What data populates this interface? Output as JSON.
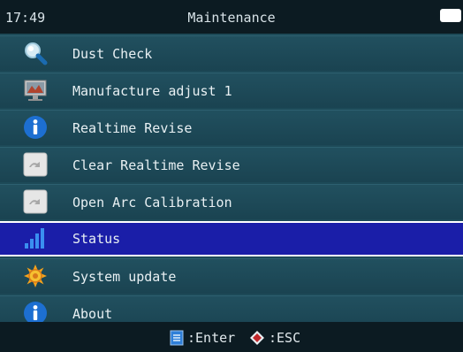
{
  "status_bar": {
    "time": "17:49",
    "title": "Maintenance"
  },
  "menu": {
    "items": [
      {
        "label": "Dust Check",
        "icon": "magnifier-icon"
      },
      {
        "label": "Manufacture adjust 1",
        "icon": "monitor-icon"
      },
      {
        "label": "Realtime Revise",
        "icon": "info-icon"
      },
      {
        "label": "Clear Realtime Revise",
        "icon": "gray-arrow-icon"
      },
      {
        "label": "Open Arc Calibration",
        "icon": "gray-arrow-icon"
      },
      {
        "label": "Status",
        "icon": "signal-bars-icon",
        "selected": true
      },
      {
        "label": "System update",
        "icon": "sun-gear-icon"
      },
      {
        "label": "About",
        "icon": "info-icon"
      }
    ]
  },
  "footer": {
    "enter_hint": ":Enter",
    "esc_hint": ":ESC"
  },
  "colors": {
    "background": "#1d4a58",
    "selected": "#1a1ea8",
    "bars": "#0c1b22"
  }
}
